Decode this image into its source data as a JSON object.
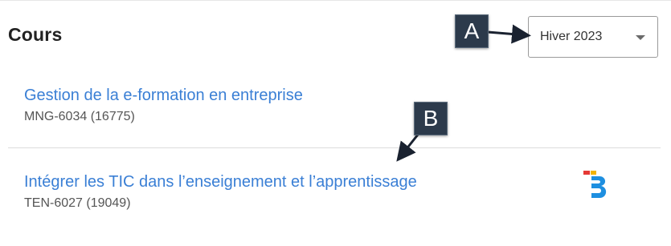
{
  "header": {
    "title": "Cours"
  },
  "session_select": {
    "selected": "Hiver 2023"
  },
  "courses": [
    {
      "name": "Gestion de la e-formation en entreprise",
      "code": "MNG-6034 (16775)"
    },
    {
      "name": "Intégrer les TIC dans l’enseignement et l’apprentissage",
      "code": "TEN-6027 (19049)"
    }
  ],
  "callouts": {
    "a": "A",
    "b": "B"
  },
  "colors": {
    "link": "#3a7fd5",
    "callout_bg": "#2c3a4b",
    "logo_blue": "#1e8fe0",
    "logo_red": "#e53935",
    "logo_yellow": "#f5b400"
  },
  "icons": {
    "logo": "b-app-logo-icon",
    "dropdown": "chevron-down-icon"
  }
}
